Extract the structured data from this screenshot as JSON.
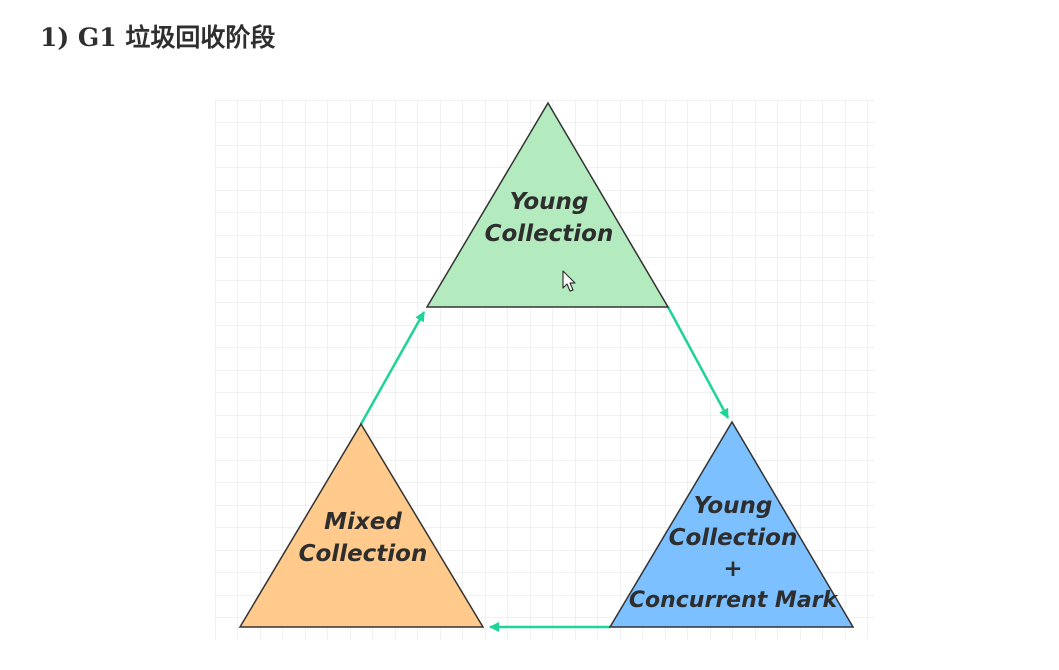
{
  "heading": "1) G1 垃圾回收阶段",
  "colors": {
    "grid": "#e3e3e3",
    "young": "#b3ebbf",
    "mixed": "#ffca8b",
    "concurrent": "#7cc0ff",
    "arrow": "#1fd497",
    "stroke": "#333333"
  },
  "stages": {
    "young": {
      "line1": "Young",
      "line2": "Collection"
    },
    "concurrent": {
      "line1": "Young",
      "line2": "Collection",
      "line3": "+",
      "line4": "Concurrent Mark"
    },
    "mixed": {
      "line1": "Mixed",
      "line2": "Collection"
    }
  },
  "icons": {
    "cursor": "mouse-pointer-icon"
  }
}
